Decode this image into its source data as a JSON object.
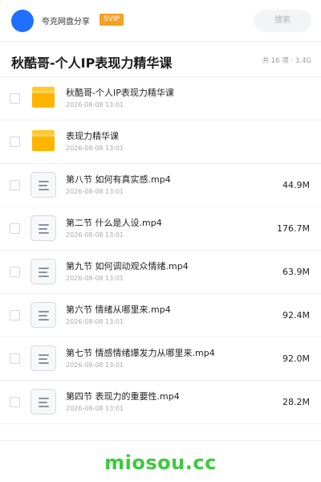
{
  "header": {
    "username": "夸克网盘分享",
    "badge": "SVIP",
    "search_placeholder": "搜索"
  },
  "folder": {
    "title": "秋酷哥-个人IP表现力精华课",
    "summary": "共 16 项 · 3.4G"
  },
  "files": [
    {
      "type": "folder",
      "name": "秋酷哥-个人IP表现力精华课",
      "date": "2026-08-08 13:01",
      "size": ""
    },
    {
      "type": "folder",
      "name": "表现力精华课",
      "date": "2026-08-08 13:01",
      "size": ""
    },
    {
      "type": "file",
      "name": "第八节 如何有真实感.mp4",
      "date": "2026-08-08 13:01",
      "size": "44.9M"
    },
    {
      "type": "file",
      "name": "第二节 什么是人设.mp4",
      "date": "2026-08-08 13:01",
      "size": "176.7M"
    },
    {
      "type": "file",
      "name": "第九节 如何调动观众情绪.mp4",
      "date": "2026-08-08 13:01",
      "size": "63.9M"
    },
    {
      "type": "file",
      "name": "第六节 情绪从哪里来.mp4",
      "date": "2026-08-08 13:01",
      "size": "92.4M"
    },
    {
      "type": "file",
      "name": "第七节 情感情绪爆发力从哪里来.mp4",
      "date": "2026-08-08 13:01",
      "size": "92.0M"
    },
    {
      "type": "file",
      "name": "第四节 表现力的重要性.mp4",
      "date": "2026-08-08 13:01",
      "size": "28.2M"
    }
  ],
  "watermark": "miosou.cc",
  "colors": {
    "accent": "#1f6fff",
    "svip": "#f7a01f",
    "folder": "#ffb400",
    "watermark": "#3dc93d"
  },
  "icons": {
    "folder": "folder-icon",
    "file": "video-file-icon"
  }
}
